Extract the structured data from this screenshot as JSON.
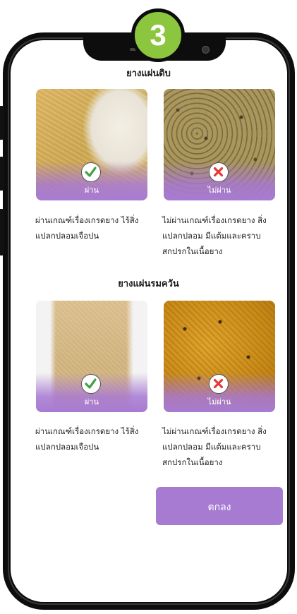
{
  "step": {
    "number": "3",
    "color": "#8cc63f"
  },
  "sections": [
    {
      "title": "ยางแผ่นดิบ",
      "cards": [
        {
          "status": "pass",
          "label": "ผ่าน",
          "icon": "check-icon",
          "description": [
            "ผ่านเกณฑ์เรื่องเกรดยาง ไร้สิ่ง",
            "แปลกปลอมเจือปน"
          ]
        },
        {
          "status": "fail",
          "label": "ไม่ผ่าน",
          "icon": "cross-icon",
          "description": [
            "ไม่ผ่านเกณฑ์เรื่องเกรดยาง สิ่ง",
            "แปลกปลอม มีแต้มและคราบ",
            "สกปรกในเนื้อยาง"
          ]
        }
      ]
    },
    {
      "title": "ยางแผ่นรมควัน",
      "cards": [
        {
          "status": "pass",
          "label": "ผ่าน",
          "icon": "check-icon",
          "description": [
            "ผ่านเกณฑ์เรื่องเกรดยาง ไร้สิ่ง",
            "แปลกปลอมเจือปน"
          ]
        },
        {
          "status": "fail",
          "label": "ไม่ผ่าน",
          "icon": "cross-icon",
          "description": [
            "ไม่ผ่านเกณฑ์เรื่องเกรดยาง สิ่ง",
            "แปลกปลอม มีแต้มและคราบ",
            "สกปรกในเนื้อยาง"
          ]
        }
      ]
    }
  ],
  "ok_button": {
    "label": "ตกลง"
  },
  "colors": {
    "accent": "#a77bd2",
    "pass": "#8cc63f",
    "fail": "#e53935"
  }
}
